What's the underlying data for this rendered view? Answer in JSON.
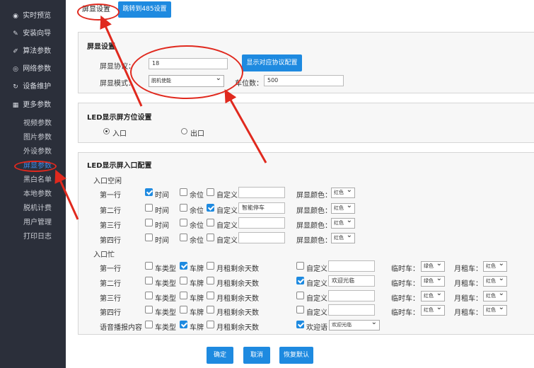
{
  "sidebar": {
    "items": [
      {
        "label": "实时预览",
        "icon": "eye-icon"
      },
      {
        "label": "安装向导",
        "icon": "wrench-icon"
      },
      {
        "label": "算法参数",
        "icon": "pencil-icon"
      },
      {
        "label": "网络参数",
        "icon": "network-icon"
      },
      {
        "label": "设备维护",
        "icon": "refresh-icon"
      },
      {
        "label": "更多参数",
        "icon": "grid-icon"
      }
    ],
    "subitems": [
      "视频参数",
      "图片参数",
      "外设参数",
      "屏显参数",
      "黑白名单",
      "本地参数",
      "脱机计费",
      "用户管理",
      "打印日志"
    ],
    "active_subitem": "屏显参数"
  },
  "tabs": {
    "current": "屏显设置",
    "jump_button": "跳转到485设置"
  },
  "display_settings": {
    "title": "屏显设置",
    "protocol_label": "屏显协议：",
    "protocol_value": "18",
    "show_protocol_button": "显示对应协议配置",
    "mode_label": "屏显模式：",
    "mode_value": "脱机使能",
    "spaces_label": "车位数：",
    "spaces_value": "500"
  },
  "orientation": {
    "title": "LED显示屏方位设置",
    "options": [
      "入口",
      "出口"
    ],
    "selected": "入口"
  },
  "entry_config": {
    "title": "LED显示屏入口配置",
    "idle_section": "入口空闲",
    "idle_rows": [
      {
        "row": "第一行",
        "time": true,
        "spaces": false,
        "custom": false,
        "custom_text": "",
        "color_label": "屏显颜色：",
        "color": "红色"
      },
      {
        "row": "第二行",
        "time": false,
        "spaces": false,
        "custom": true,
        "custom_text": "智能停车",
        "color_label": "屏显颜色：",
        "color": "红色"
      },
      {
        "row": "第三行",
        "time": false,
        "spaces": false,
        "custom": false,
        "custom_text": "",
        "color_label": "屏显颜色：",
        "color": "红色"
      },
      {
        "row": "第四行",
        "time": false,
        "spaces": false,
        "custom": false,
        "custom_text": "",
        "color_label": "屏显颜色：",
        "color": "红色"
      }
    ],
    "idle_labels": {
      "time": "时间",
      "spaces": "余位",
      "custom": "自定义"
    },
    "busy_section": "入口忙",
    "busy_labels": {
      "car_type": "车类型",
      "plate": "车牌",
      "monthly_days": "月租剩余天数",
      "custom": "自定义",
      "temp_car": "临时车：",
      "monthly_car": "月租车："
    },
    "busy_rows": [
      {
        "row": "第一行",
        "car_type": false,
        "plate": true,
        "monthly_days": false,
        "custom": false,
        "custom_text": "",
        "temp_color": "绿色",
        "monthly_color": "红色"
      },
      {
        "row": "第二行",
        "car_type": false,
        "plate": false,
        "monthly_days": false,
        "custom": true,
        "custom_text": "欢迎光临",
        "temp_color": "绿色",
        "monthly_color": "红色"
      },
      {
        "row": "第三行",
        "car_type": false,
        "plate": false,
        "monthly_days": false,
        "custom": false,
        "custom_text": "",
        "temp_color": "红色",
        "monthly_color": "红色"
      },
      {
        "row": "第四行",
        "car_type": false,
        "plate": false,
        "monthly_days": false,
        "custom": false,
        "custom_text": "",
        "temp_color": "红色",
        "monthly_color": "红色"
      }
    ],
    "voice_row": {
      "row": "语音播报内容",
      "car_type": false,
      "plate": true,
      "monthly_days": false,
      "welcome": true,
      "welcome_label": "欢迎语",
      "welcome_value": "欢迎光临"
    }
  },
  "actions": {
    "confirm": "确定",
    "cancel": "取消",
    "restore": "恢复默认"
  },
  "colors": {
    "sidebar_bg": "#2b2f3a",
    "accent": "#1e8ae0",
    "annotation": "#e0291e"
  }
}
